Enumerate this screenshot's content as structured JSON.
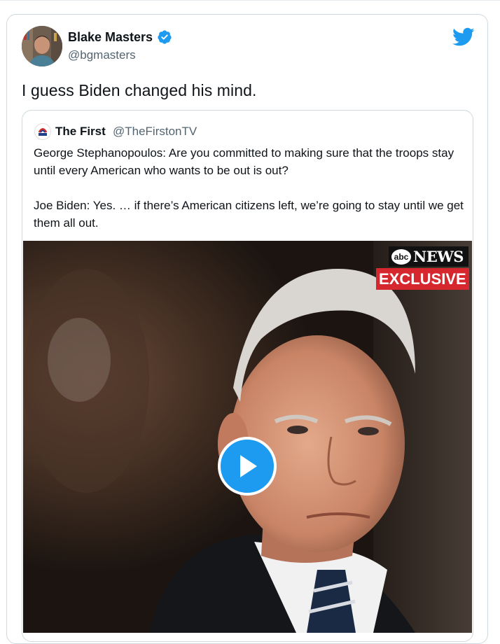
{
  "tweet": {
    "author_name": "Blake Masters",
    "author_handle": "@bgmasters",
    "verified": true,
    "text": "I guess Biden changed his mind."
  },
  "quoted_tweet": {
    "author_name": "The First",
    "author_handle": "@TheFirstonTV",
    "paragraphs": [
      "George Stephanopoulos: Are you committed to making sure that the troops stay until every American who wants to be out is out?",
      "Joe Biden: Yes. … if there’s American citizens left, we’re going to stay until we get them all out."
    ],
    "video": {
      "badge_logo": "abc",
      "badge_network": "NEWS",
      "badge_exclusive": "EXCLUSIVE"
    }
  },
  "icons": {
    "verified": "verified-badge-icon",
    "brand": "twitter-bird-icon",
    "play": "play-icon"
  },
  "colors": {
    "accent": "#1d9bf0",
    "text": "#0f1419",
    "secondary": "#536471",
    "exclusive_red": "#d6262e"
  }
}
